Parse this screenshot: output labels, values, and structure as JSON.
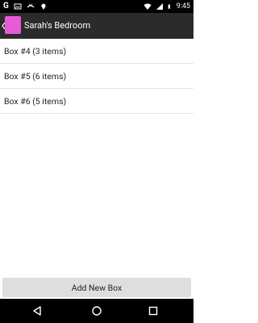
{
  "status_bar": {
    "left_icons": [
      "google-icon",
      "image-icon",
      "missed-call-icon",
      "location-pin-icon"
    ],
    "google_letter": "G",
    "right_icons": [
      "wifi-icon",
      "signal-icon",
      "battery-icon"
    ],
    "time": "9:45"
  },
  "app_bar": {
    "title": "Sarah's Bedroom",
    "logo_color": "#e85ad8",
    "background": "#2b2b2b"
  },
  "boxes": [
    {
      "label": "Box #4 (3 items)"
    },
    {
      "label": "Box #5 (6 items)"
    },
    {
      "label": "Box #6 (5 items)"
    }
  ],
  "add_button": {
    "label": "Add New Box"
  },
  "nav_bar": {
    "buttons": [
      "back-icon",
      "home-icon",
      "recents-icon"
    ]
  }
}
